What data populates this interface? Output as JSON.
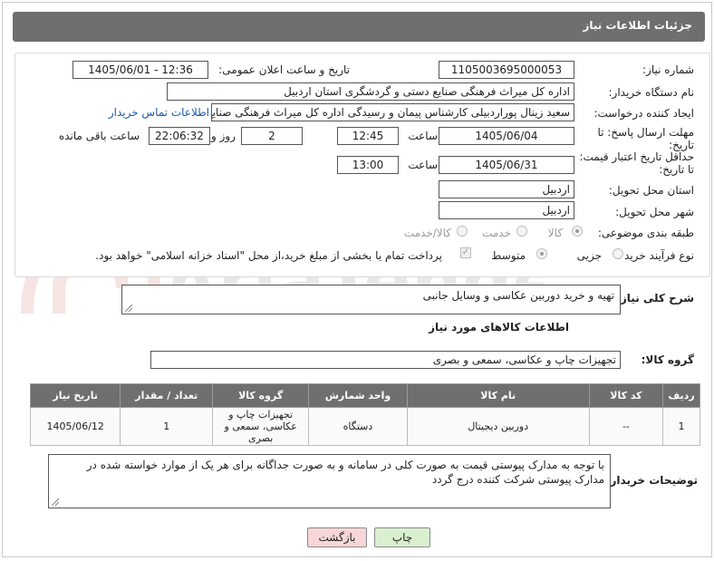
{
  "header": {
    "title": "جزئیات اطلاعات نیاز"
  },
  "form": {
    "need_number_label": "شماره نیاز:",
    "need_number": "1105003695000053",
    "announce_label": "تاریخ و ساعت اعلان عمومی:",
    "announce_value": "1405/06/01 - 12:36",
    "buyer_org_label": "نام دستگاه خریدار:",
    "buyer_org": "اداره کل میراث فرهنگی  صنایع دستی و گردشگری استان اردبیل",
    "creator_label": "ایجاد کننده درخواست:",
    "creator": "سعید زینال پوراردبیلی کارشناس پیمان و رسیدگی اداره کل میراث فرهنگی  صنایع",
    "contact_link": "اطلاعات تماس خریدار",
    "reply_deadline_label": "مهلت ارسال پاسخ: تا تاریخ:",
    "reply_date": "1405/06/04",
    "time_label": "ساعت",
    "reply_time": "12:45",
    "days_value": "2",
    "days_label": "روز و",
    "remaining_time": "22:06:32",
    "remaining_label": "ساعت باقی مانده",
    "price_validity_label": "حداقل تاریخ اعتبار قیمت: تا تاریخ:",
    "price_date": "1405/06/31",
    "price_time": "13:00",
    "province_label": "استان محل تحویل:",
    "province": "اردبیل",
    "city_label": "شهر محل تحویل:",
    "city": "اردبیل",
    "category_label": "طبقه بندی موضوعی:",
    "category_options": [
      "کالا",
      "خدمت",
      "کالا/خدمت"
    ],
    "process_label": "نوع فرآیند خرید :",
    "process_options": [
      "جزیی",
      "متوسط"
    ],
    "payment_note": "پرداخت تمام یا بخشی از مبلغ خرید،از محل \"اسناد خزانه اسلامی\" خواهد بود."
  },
  "summary": {
    "label": "شرح کلی نیاز:",
    "value": "تهیه و خرید دوربین عکاسی و وسایل جانبی"
  },
  "goods_section": {
    "title": "اطلاعات کالاهای مورد نیاز",
    "group_label": "گروه کالا:",
    "group_value": "تجهیزات چاپ و عکاسی، سمعی و بصری"
  },
  "table": {
    "headers": [
      "ردیف",
      "کد کالا",
      "نام کالا",
      "واحد شمارش",
      "گروه کالا",
      "تعداد / مقدار",
      "تاریخ نیاز"
    ],
    "rows": [
      [
        "1",
        "--",
        "دوربین دیجیتال",
        "دستگاه",
        "تجهیزات چاپ و عکاسی، سمعی و بصری",
        "1",
        "1405/06/12"
      ]
    ]
  },
  "buyer_notes": {
    "label": "توضیحات خریدار:",
    "value": "با توجه به مدارک پیوستی قیمت به صورت کلی در سامانه و به صورت جداگانه برای هر یک از موارد خواسته شده در مدارک پیوستی شرکت کننده درج گردد"
  },
  "buttons": {
    "print": "چاپ",
    "back": "بازگشت"
  },
  "watermark_text": "AriaTender.neT",
  "colors": {
    "header_bg": "#6f6f6f",
    "print_btn": "#d9f0d0",
    "back_btn": "#f6d6d6",
    "link": "#1b5aa8"
  }
}
